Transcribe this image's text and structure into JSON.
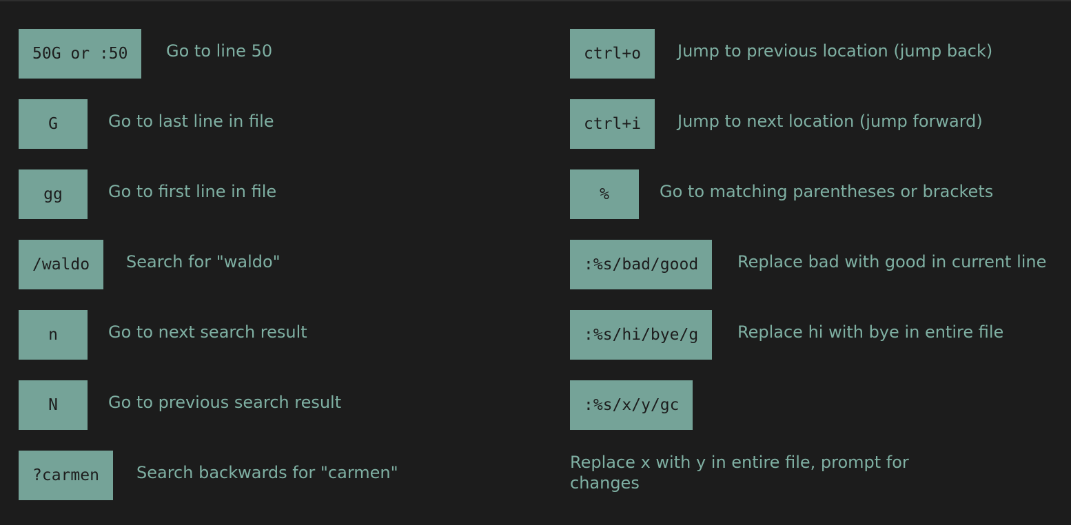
{
  "left_column": [
    {
      "key": "50G or :50",
      "description": "Go to line 50"
    },
    {
      "key": "G",
      "description": "Go to last line in file"
    },
    {
      "key": "gg",
      "description": "Go to first line in file"
    },
    {
      "key": "/waldo",
      "description": "Search for \"waldo\""
    },
    {
      "key": "n",
      "description": "Go to next search result"
    },
    {
      "key": "N",
      "description": "Go to previous search result"
    },
    {
      "key": "?carmen",
      "description": "Search backwards for \"carmen\""
    }
  ],
  "right_column": [
    {
      "key": "ctrl+o",
      "description": "Jump to previous location (jump back)"
    },
    {
      "key": "ctrl+i",
      "description": "Jump to next location (jump forward)"
    },
    {
      "key": "%",
      "description": "Go to matching parentheses or brackets"
    },
    {
      "key": ":%s/bad/good",
      "description": "Replace bad with good in current line"
    },
    {
      "key": ":%s/hi/bye/g",
      "description": "Replace hi with bye in entire file"
    },
    {
      "key": ":%s/x/y/gc",
      "description": ""
    },
    {
      "key": "",
      "description": "Replace x with y in entire file, prompt for changes"
    }
  ],
  "colors": {
    "background": "#1c1c1c",
    "key_background": "#75a398",
    "key_text": "#1d1d1d",
    "description_text": "#7fb0a3"
  }
}
